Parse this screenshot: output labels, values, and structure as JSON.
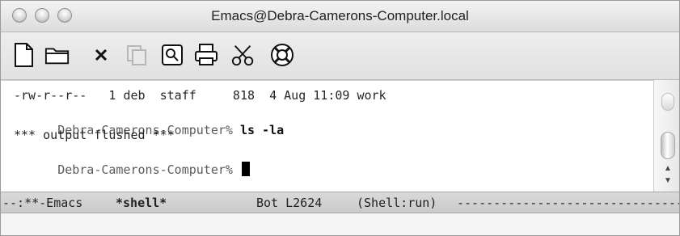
{
  "window": {
    "title": "Emacs@Debra-Camerons-Computer.local"
  },
  "toolbar": {
    "tools": [
      {
        "name": "new-file-icon"
      },
      {
        "name": "open-folder-icon"
      },
      {
        "name": "close-x-icon"
      },
      {
        "name": "copy-icon"
      },
      {
        "name": "search-icon"
      },
      {
        "name": "print-icon"
      },
      {
        "name": "cut-scissors-icon"
      },
      {
        "name": "lifebuoy-help-icon"
      }
    ]
  },
  "terminal": {
    "lines": [
      {
        "text": "-rw-r--r--   1 deb  staff     818  4 Aug 11:09 work"
      },
      {
        "prompt": "Debra-Camerons-Computer% ",
        "command": "ls -la"
      },
      {
        "text": "*** output flushed ***"
      },
      {
        "prompt": "Debra-Camerons-Computer% "
      }
    ]
  },
  "modeline": {
    "status": "--:**-Emacs",
    "buffer": "*shell*",
    "position": "Bot L2624",
    "mode": "(Shell:run)",
    "fill": "---------------------------------------------------------------"
  }
}
